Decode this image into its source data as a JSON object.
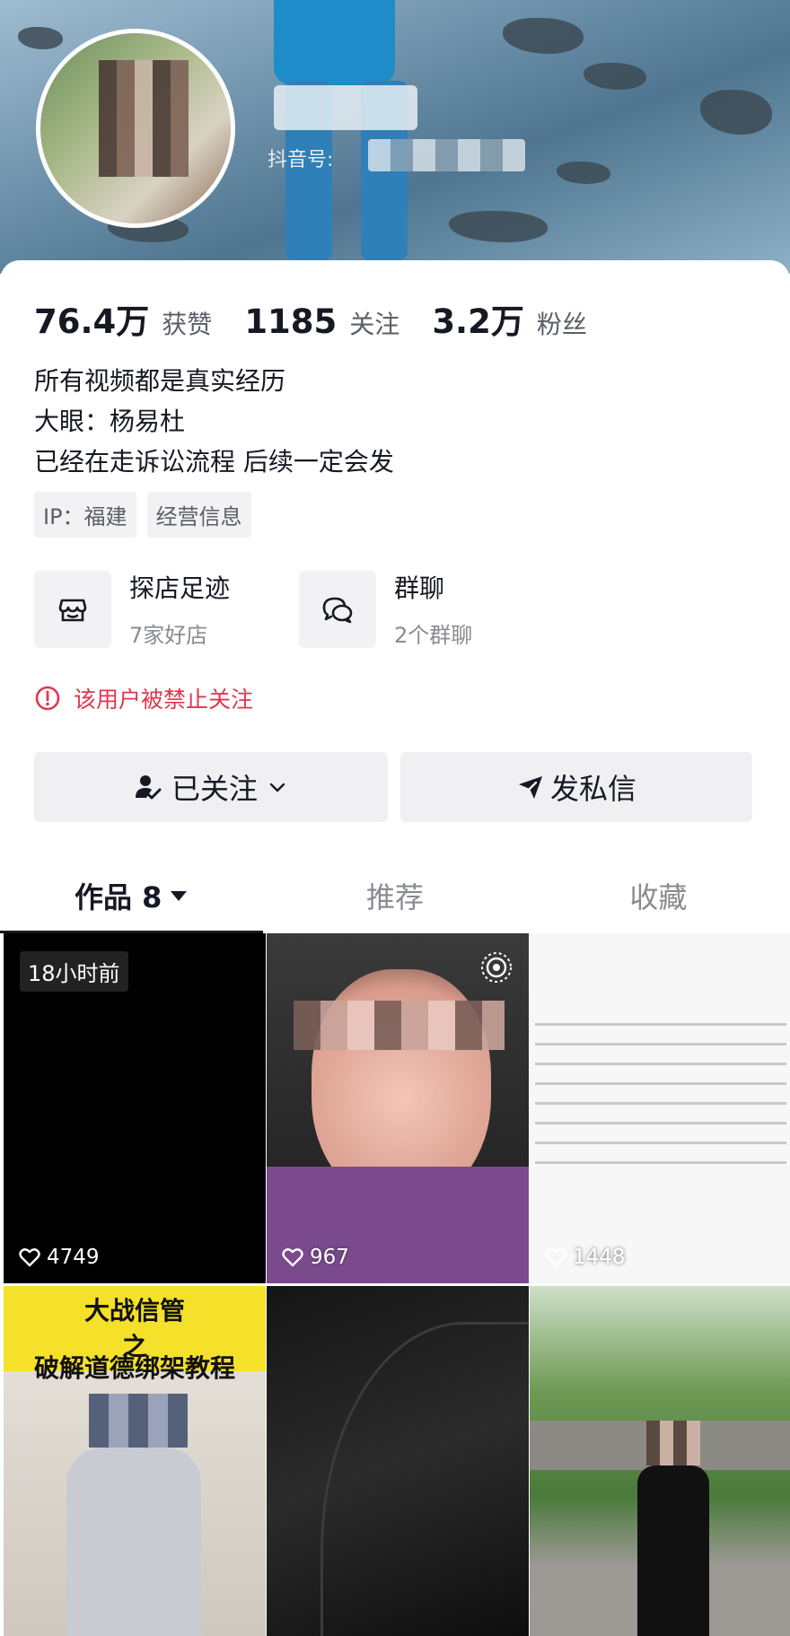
{
  "profile": {
    "douyin_id_label": "抖音号:"
  },
  "stats": [
    {
      "value": "76.4万",
      "label": "获赞"
    },
    {
      "value": "1185",
      "label": "关注"
    },
    {
      "value": "3.2万",
      "label": "粉丝"
    }
  ],
  "bio": {
    "line1": "所有视频都是真实经历",
    "line2": "大眼：杨易杜",
    "line3": "已经在走诉讼流程 后续一定会发"
  },
  "tags": {
    "ip": "IP：福建",
    "business": "经营信息"
  },
  "features": {
    "shop": {
      "title": "探店足迹",
      "sub": "7家好店"
    },
    "group": {
      "title": "群聊",
      "sub": "2个群聊"
    }
  },
  "warning": "该用户被禁止关注",
  "buttons": {
    "followed": "已关注",
    "message": "发私信"
  },
  "tabs": {
    "works": "作品 8",
    "recommend": "推荐",
    "favorites": "收藏"
  },
  "videos": [
    {
      "badge": "18小时前",
      "likes": "4749"
    },
    {
      "likes": "967"
    },
    {
      "likes": "1448"
    },
    {
      "title_line1": "大战信管",
      "title_line2": "之",
      "title_line3": "破解道德绑架教程"
    },
    {},
    {}
  ],
  "colors": {
    "warning": "#e1364f",
    "text_primary": "#161823",
    "text_secondary": "#8a8b91"
  }
}
